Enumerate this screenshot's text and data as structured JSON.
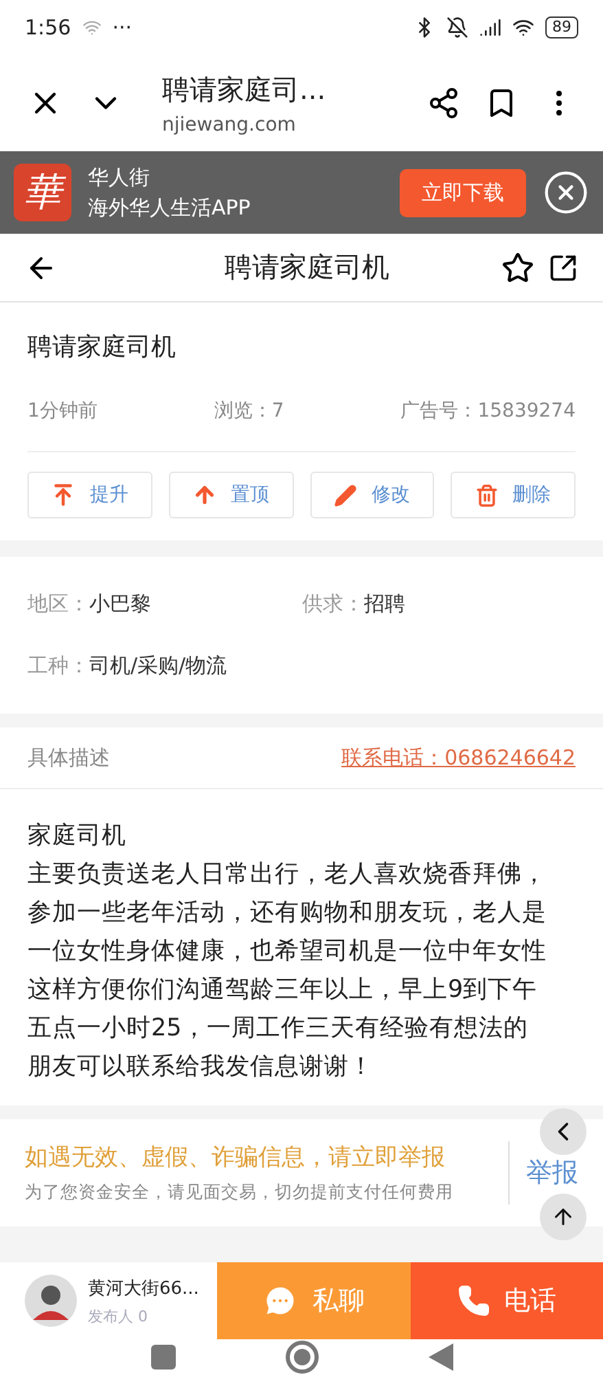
{
  "status_bar": {
    "time": "1:56",
    "dots": "···",
    "battery": "89"
  },
  "browser_bar": {
    "title": "聘请家庭司...",
    "url": "njiewang.com"
  },
  "app_banner": {
    "logo": "華",
    "name": "华人街",
    "tagline": "海外华人生活APP",
    "button": "立即下载"
  },
  "header": {
    "title": "聘请家庭司机"
  },
  "post": {
    "title": "聘请家庭司机",
    "time": "1分钟前",
    "views": "浏览：7",
    "ad_number": "广告号：15839274"
  },
  "actions": [
    {
      "kind": "promote",
      "label": "提升"
    },
    {
      "kind": "top",
      "label": "置顶"
    },
    {
      "kind": "edit",
      "label": "修改"
    },
    {
      "kind": "delete",
      "label": "删除"
    }
  ],
  "info": [
    {
      "label": "地区：",
      "value": "小巴黎"
    },
    {
      "label": "供求：",
      "value": "招聘"
    },
    {
      "label": "工种：",
      "value": "司机/采购/物流"
    }
  ],
  "description": {
    "heading": "具体描述",
    "phone_link": "联系电话：0686246642",
    "paragraphs": [
      "家庭司机",
      "主要负责送老人日常出行，老人喜欢烧香拜佛，参加一些老年活动，还有购物和朋友玩，老人是一位女性身体健康，也希望司机是一位中年女性这样方便你们沟通驾龄三年以上，早上9到下午五点一小时25，一周工作三天有经验有想法的朋友可以联系给我发信息谢谢！"
    ]
  },
  "notice": {
    "warning": "如遇无效、虚假、诈骗信息，请立即举报",
    "tip": "为了您资金安全，请见面交易，切勿提前支付任何费用",
    "report": "举报"
  },
  "bottom_bar": {
    "poster_name": "黄河大街66...",
    "poster_role": "发布人 0",
    "chat": "私聊",
    "call": "电话"
  }
}
